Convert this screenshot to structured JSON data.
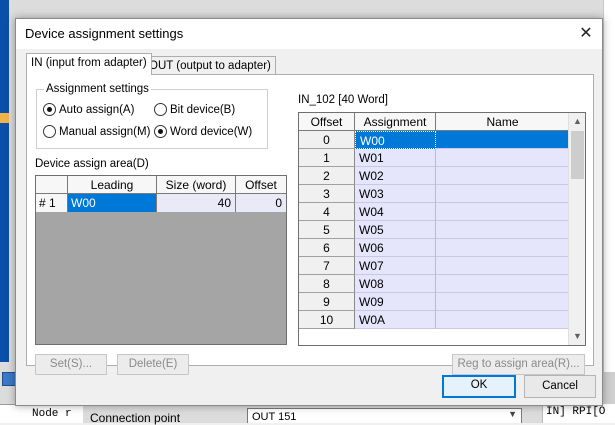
{
  "background": {
    "bottom_left_text": "Node r",
    "connection_label": "Connection point",
    "connection_value": "OUT 151",
    "right_text": "IN] RPI[O"
  },
  "dialog": {
    "title": "Device assignment settings",
    "close_glyph": "✕",
    "tabs": [
      {
        "label": "IN (input from adapter)",
        "active": true
      },
      {
        "label": "OUT (output to adapter)",
        "active": false
      }
    ],
    "assignment_group": {
      "title": "Assignment settings",
      "options": [
        {
          "label": "Auto assign(A)",
          "selected": true
        },
        {
          "label": "Bit device(B)",
          "selected": false
        },
        {
          "label": "Manual assign(M)",
          "selected": false
        },
        {
          "label": "Word device(W)",
          "selected": true
        }
      ]
    },
    "area_label": "Device assign area(D)",
    "area_table": {
      "headers": [
        "",
        "Leading",
        "Size (word)",
        "Offset"
      ],
      "rows": [
        {
          "index": "# 1",
          "leading": "W00",
          "size": "40",
          "offset": "0"
        }
      ]
    },
    "in_label": "IN_102 [40 Word]",
    "map_table": {
      "headers": [
        "Offset",
        "Assignment",
        "Name"
      ],
      "rows": [
        {
          "offset": "0",
          "assignment": "W00",
          "name": ""
        },
        {
          "offset": "1",
          "assignment": "W01",
          "name": ""
        },
        {
          "offset": "2",
          "assignment": "W02",
          "name": ""
        },
        {
          "offset": "3",
          "assignment": "W03",
          "name": ""
        },
        {
          "offset": "4",
          "assignment": "W04",
          "name": ""
        },
        {
          "offset": "5",
          "assignment": "W05",
          "name": ""
        },
        {
          "offset": "6",
          "assignment": "W06",
          "name": ""
        },
        {
          "offset": "7",
          "assignment": "W07",
          "name": ""
        },
        {
          "offset": "8",
          "assignment": "W08",
          "name": ""
        },
        {
          "offset": "9",
          "assignment": "W09",
          "name": ""
        },
        {
          "offset": "10",
          "assignment": "W0A",
          "name": ""
        }
      ],
      "selected_row": 0
    },
    "buttons": {
      "set": "Set(S)...",
      "delete": "Delete(E)",
      "reg": "Reg to assign area(R)...",
      "ok": "OK",
      "cancel": "Cancel"
    },
    "scroll_up_icon": "▲",
    "scroll_down_icon": "▼",
    "colors": {
      "selection": "#0078d7",
      "assignment_cell": "#e5e5fb",
      "grid_empty": "#a5a5a5"
    }
  }
}
